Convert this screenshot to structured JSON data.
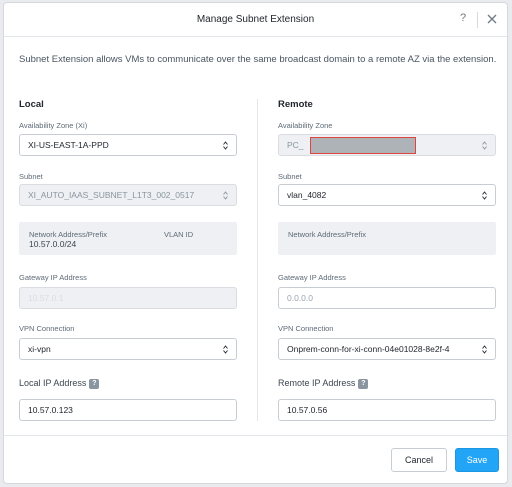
{
  "modal": {
    "title": "Manage Subnet Extension",
    "help_icon": "?"
  },
  "description": "Subnet Extension allows VMs to communicate over the same broadcast domain to a remote AZ via the extension.",
  "local": {
    "title": "Local",
    "availability_zone_label": "Availability Zone (Xi)",
    "availability_zone_value": "XI-US-EAST-1A-PPD",
    "subnet_label": "Subnet",
    "subnet_value": "XI_AUTO_IAAS_SUBNET_L1T3_002_0517",
    "network_label": "Network Address/Prefix",
    "network_value": "10.57.0.0/24",
    "vlan_label": "VLAN ID",
    "gateway_label": "Gateway IP Address",
    "gateway_value": "10.57.0.1",
    "vpn_label": "VPN Connection",
    "vpn_value": "xi-vpn",
    "ip_label": "Local IP Address",
    "ip_value": "10.57.0.123"
  },
  "remote": {
    "title": "Remote",
    "availability_zone_label": "Availability Zone",
    "availability_zone_value": "PC_",
    "subnet_label": "Subnet",
    "subnet_value": "vlan_4082",
    "network_label": "Network Address/Prefix",
    "gateway_label": "Gateway IP Address",
    "gateway_placeholder": "0.0.0.0",
    "vpn_label": "VPN Connection",
    "vpn_value": "Onprem-conn-for-xi-conn-04e01028-8e2f-4",
    "ip_label": "Remote IP Address",
    "ip_value": "10.57.0.56"
  },
  "footer": {
    "cancel_label": "Cancel",
    "save_label": "Save"
  },
  "colors": {
    "primary": "#22a5f7",
    "redaction_border": "#e0443e"
  }
}
